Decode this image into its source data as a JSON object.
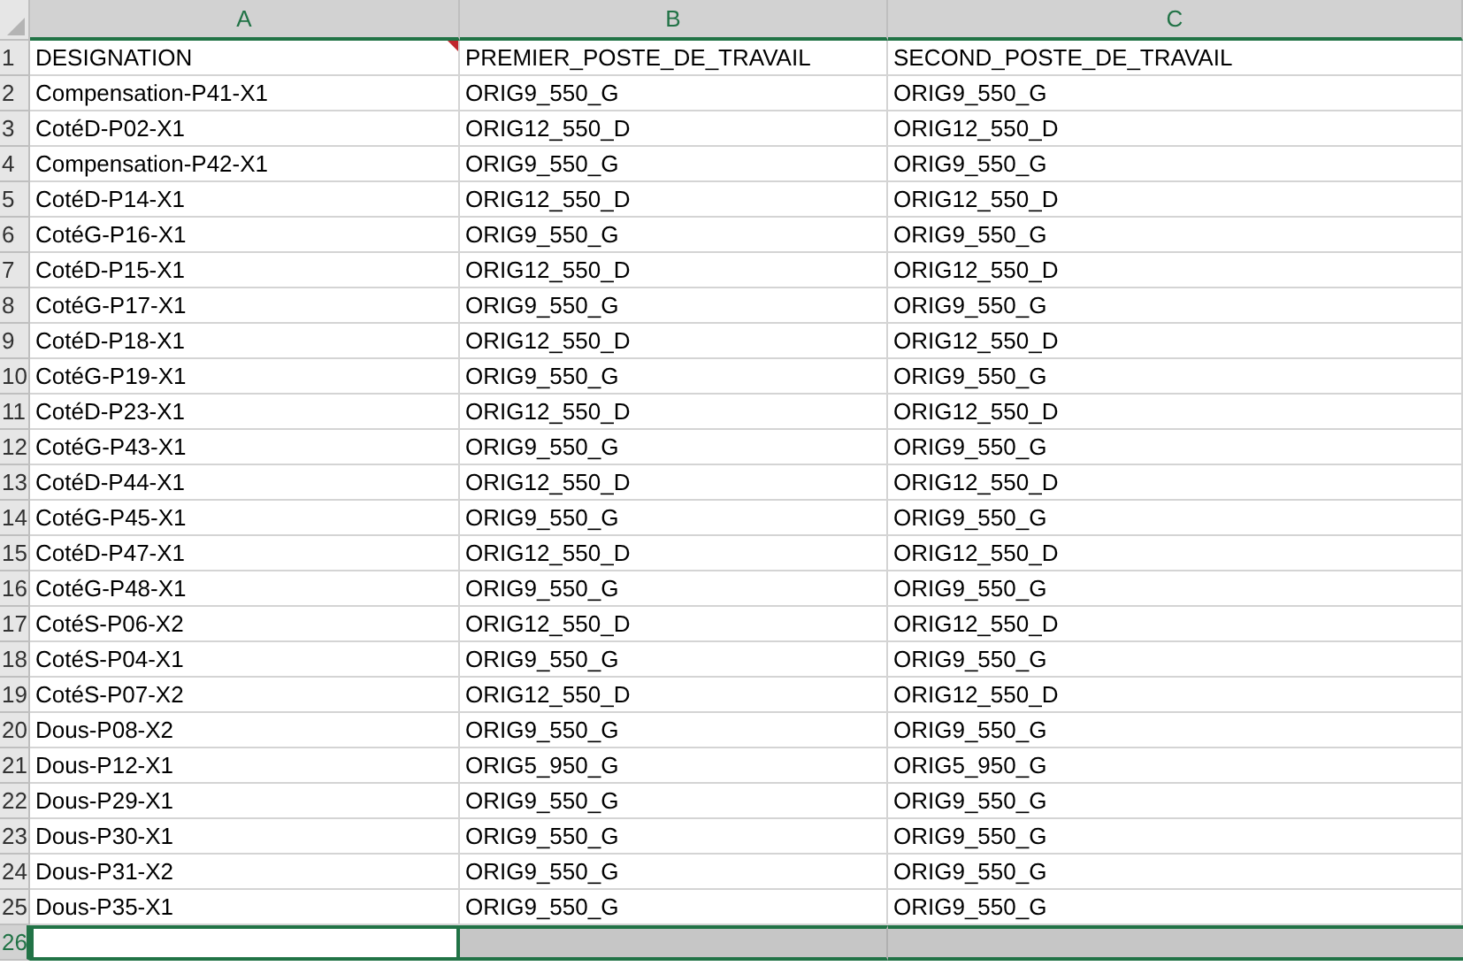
{
  "columns": [
    {
      "label": "A",
      "selected": true
    },
    {
      "label": "B",
      "selected": true
    },
    {
      "label": "C",
      "selected": true
    }
  ],
  "rows": [
    {
      "number": "1",
      "selected": false,
      "cells": [
        {
          "text": "DESIGNATION",
          "comment": true
        },
        "PREMIER_POSTE_DE_TRAVAIL",
        "SECOND_POSTE_DE_TRAVAIL"
      ]
    },
    {
      "number": "2",
      "selected": false,
      "cells": [
        "Compensation-P41-X1",
        "ORIG9_550_G",
        "ORIG9_550_G"
      ]
    },
    {
      "number": "3",
      "selected": false,
      "cells": [
        "CotéD-P02-X1",
        "ORIG12_550_D",
        "ORIG12_550_D"
      ]
    },
    {
      "number": "4",
      "selected": false,
      "cells": [
        "Compensation-P42-X1",
        "ORIG9_550_G",
        "ORIG9_550_G"
      ]
    },
    {
      "number": "5",
      "selected": false,
      "cells": [
        "CotéD-P14-X1",
        "ORIG12_550_D",
        "ORIG12_550_D"
      ]
    },
    {
      "number": "6",
      "selected": false,
      "cells": [
        "CotéG-P16-X1",
        "ORIG9_550_G",
        "ORIG9_550_G"
      ]
    },
    {
      "number": "7",
      "selected": false,
      "cells": [
        "CotéD-P15-X1",
        "ORIG12_550_D",
        "ORIG12_550_D"
      ]
    },
    {
      "number": "8",
      "selected": false,
      "cells": [
        "CotéG-P17-X1",
        "ORIG9_550_G",
        "ORIG9_550_G"
      ]
    },
    {
      "number": "9",
      "selected": false,
      "cells": [
        "CotéD-P18-X1",
        "ORIG12_550_D",
        "ORIG12_550_D"
      ]
    },
    {
      "number": "10",
      "selected": false,
      "cells": [
        "CotéG-P19-X1",
        "ORIG9_550_G",
        "ORIG9_550_G"
      ]
    },
    {
      "number": "11",
      "selected": false,
      "cells": [
        "CotéD-P23-X1",
        "ORIG12_550_D",
        "ORIG12_550_D"
      ]
    },
    {
      "number": "12",
      "selected": false,
      "cells": [
        "CotéG-P43-X1",
        "ORIG9_550_G",
        "ORIG9_550_G"
      ]
    },
    {
      "number": "13",
      "selected": false,
      "cells": [
        "CotéD-P44-X1",
        "ORIG12_550_D",
        "ORIG12_550_D"
      ]
    },
    {
      "number": "14",
      "selected": false,
      "cells": [
        "CotéG-P45-X1",
        "ORIG9_550_G",
        "ORIG9_550_G"
      ]
    },
    {
      "number": "15",
      "selected": false,
      "cells": [
        "CotéD-P47-X1",
        "ORIG12_550_D",
        "ORIG12_550_D"
      ]
    },
    {
      "number": "16",
      "selected": false,
      "cells": [
        "CotéG-P48-X1",
        "ORIG9_550_G",
        "ORIG9_550_G"
      ]
    },
    {
      "number": "17",
      "selected": false,
      "cells": [
        "CotéS-P06-X2",
        "ORIG12_550_D",
        "ORIG12_550_D"
      ]
    },
    {
      "number": "18",
      "selected": false,
      "cells": [
        "CotéS-P04-X1",
        "ORIG9_550_G",
        "ORIG9_550_G"
      ]
    },
    {
      "number": "19",
      "selected": false,
      "cells": [
        "CotéS-P07-X2",
        "ORIG12_550_D",
        "ORIG12_550_D"
      ]
    },
    {
      "number": "20",
      "selected": false,
      "cells": [
        "Dous-P08-X2",
        "ORIG9_550_G",
        "ORIG9_550_G"
      ]
    },
    {
      "number": "21",
      "selected": false,
      "cells": [
        "Dous-P12-X1",
        "ORIG5_950_G",
        "ORIG5_950_G"
      ]
    },
    {
      "number": "22",
      "selected": false,
      "cells": [
        "Dous-P29-X1",
        "ORIG9_550_G",
        "ORIG9_550_G"
      ]
    },
    {
      "number": "23",
      "selected": false,
      "cells": [
        "Dous-P30-X1",
        "ORIG9_550_G",
        "ORIG9_550_G"
      ]
    },
    {
      "number": "24",
      "selected": false,
      "cells": [
        "Dous-P31-X2",
        "ORIG9_550_G",
        "ORIG9_550_G"
      ]
    },
    {
      "number": "25",
      "selected": false,
      "cells": [
        "Dous-P35-X1",
        "ORIG9_550_G",
        "ORIG9_550_G"
      ]
    },
    {
      "number": "26",
      "selected": true
    }
  ]
}
